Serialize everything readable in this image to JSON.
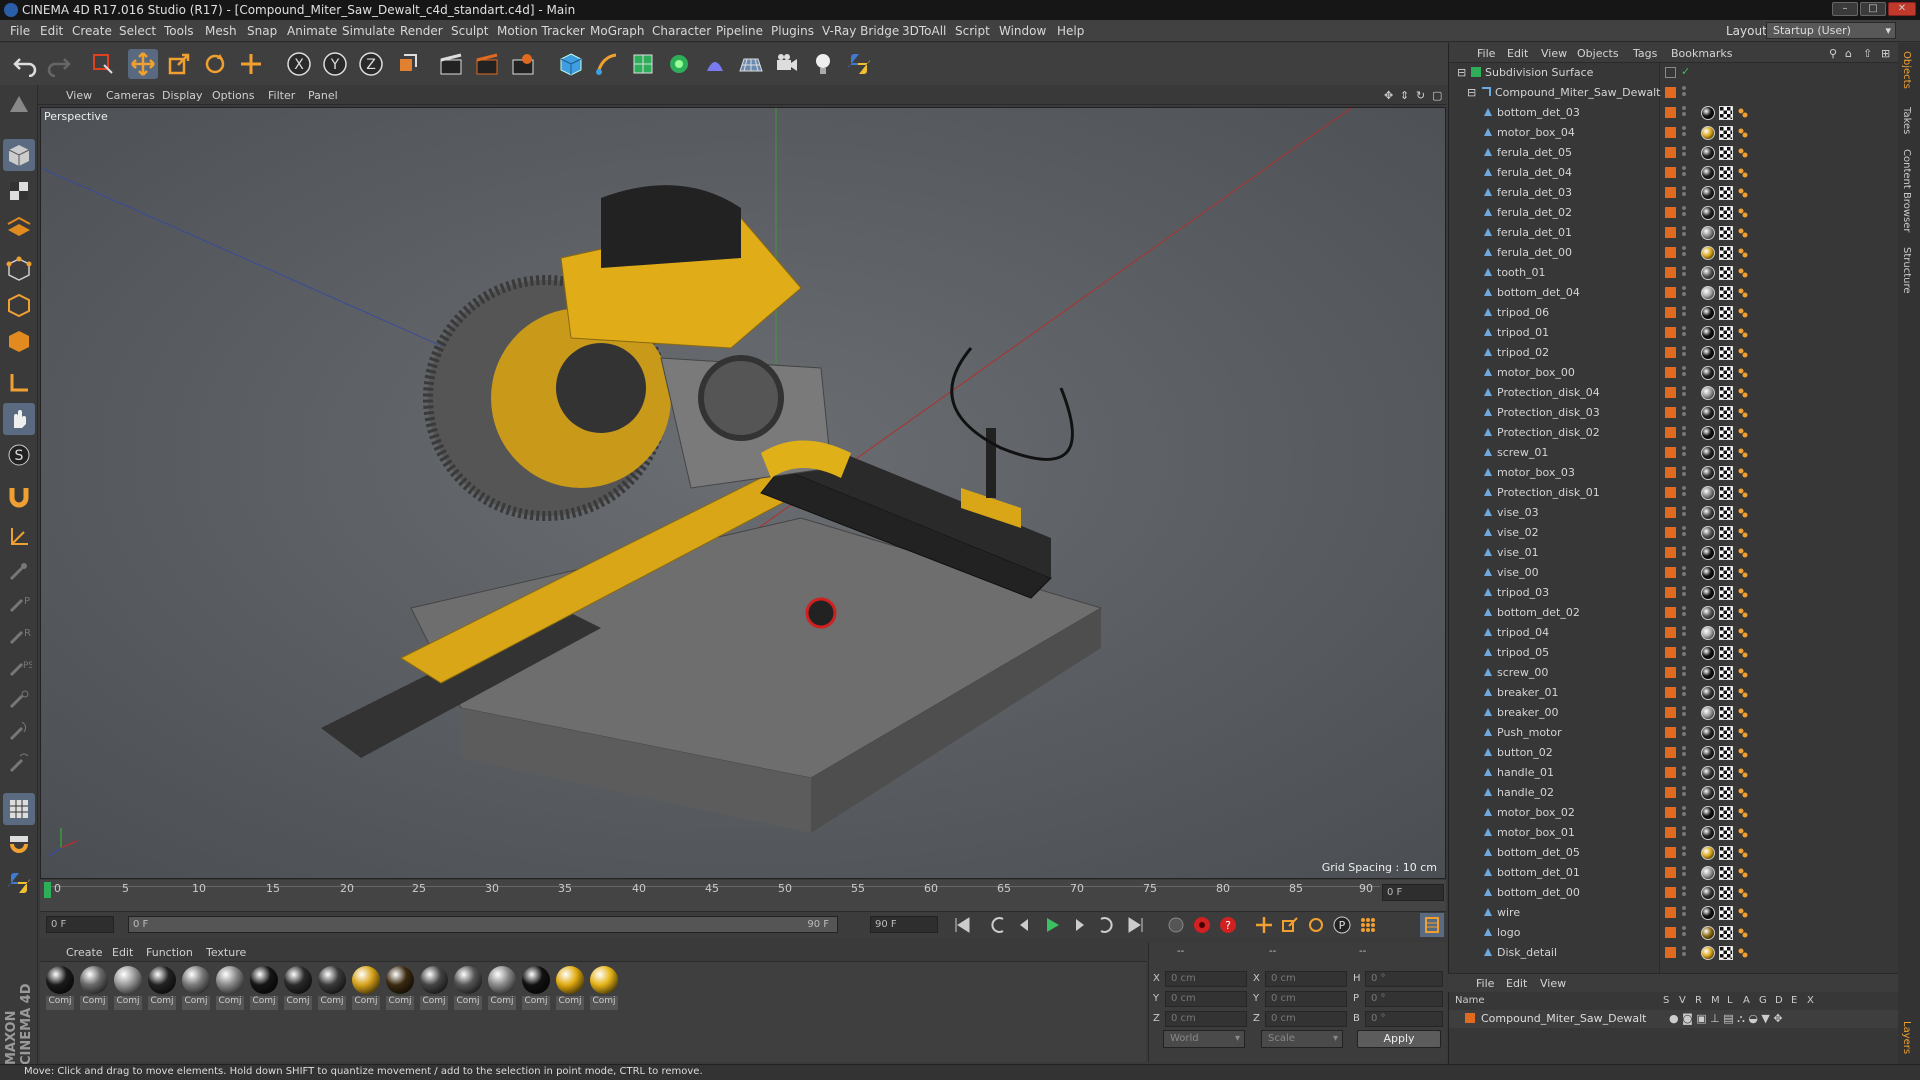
{
  "window": {
    "title": "CINEMA 4D R17.016 Studio (R17) - [Compound_Miter_Saw_Dewalt_c4d_standart.c4d] - Main"
  },
  "menu": [
    "File",
    "Edit",
    "Create",
    "Select",
    "Tools",
    "Mesh",
    "Snap",
    "Animate",
    "Simulate",
    "Render",
    "Sculpt",
    "Motion Tracker",
    "MoGraph",
    "Character",
    "Pipeline",
    "Plugins",
    "V-Ray Bridge",
    "3DToAll",
    "Script",
    "Window",
    "Help"
  ],
  "layout": {
    "label": "Layout:",
    "value": "Startup (User)"
  },
  "viewport": {
    "menu": [
      "View",
      "Cameras",
      "Display",
      "Options",
      "Filter",
      "Panel"
    ],
    "label": "Perspective",
    "grid_spacing": "Grid Spacing : 10 cm"
  },
  "timeline": {
    "ticks": [
      "0",
      "5",
      "10",
      "15",
      "20",
      "25",
      "30",
      "35",
      "40",
      "45",
      "50",
      "55",
      "60",
      "65",
      "70",
      "75",
      "80",
      "85",
      "90"
    ],
    "end_frame": "0 F",
    "current": "0 F",
    "range_start": "0 F",
    "range_end": "90 F",
    "range_end2": "90 F"
  },
  "materials": {
    "menu": [
      "Create",
      "Edit",
      "Function",
      "Texture"
    ],
    "items": [
      {
        "label": "Comj",
        "color": "#1a1a1a"
      },
      {
        "label": "Comj",
        "color": "#6a6a6a"
      },
      {
        "label": "Comj",
        "color": "#9a9a9a"
      },
      {
        "label": "Comj",
        "color": "#222222"
      },
      {
        "label": "Comj",
        "color": "#7a7a7a"
      },
      {
        "label": "Comj",
        "color": "#8a8a8a"
      },
      {
        "label": "Comj",
        "color": "#151515"
      },
      {
        "label": "Comj",
        "color": "#2a2a2a"
      },
      {
        "label": "Comj",
        "color": "#3a3a3a"
      },
      {
        "label": "Comj",
        "color": "#d7a21a"
      },
      {
        "label": "Comj",
        "color": "#3a2a10"
      },
      {
        "label": "Comj",
        "color": "#444444"
      },
      {
        "label": "Comj",
        "color": "#555555"
      },
      {
        "label": "Comj",
        "color": "#8a8a8a"
      },
      {
        "label": "Comj",
        "color": "#111111"
      },
      {
        "label": "Comj",
        "color": "#e0aa10"
      },
      {
        "label": "Comj",
        "color": "#e6b418"
      }
    ]
  },
  "coords": {
    "header": [
      "--",
      "--",
      "--"
    ],
    "rows": [
      {
        "a": "X",
        "av": "0 cm",
        "b": "X",
        "bv": "0 cm",
        "c": "H",
        "cv": "0 °"
      },
      {
        "a": "Y",
        "av": "0 cm",
        "b": "Y",
        "bv": "0 cm",
        "c": "P",
        "cv": "0 °"
      },
      {
        "a": "Z",
        "av": "0 cm",
        "b": "Z",
        "bv": "0 cm",
        "c": "B",
        "cv": "0 °"
      }
    ],
    "world": "World",
    "scale": "Scale",
    "apply": "Apply"
  },
  "status": "Move: Click and drag to move elements. Hold down SHIFT to quantize movement / add to the selection in point mode, CTRL to remove.",
  "objects": {
    "menu": [
      "File",
      "Edit",
      "View",
      "Objects",
      "Tags",
      "Bookmarks"
    ],
    "root": "Subdivision Surface",
    "group": "Compound_Miter_Saw_Dewalt",
    "items": [
      {
        "name": "bottom_det_03",
        "mat": "#111111"
      },
      {
        "name": "motor_box_04",
        "mat": "#d9a618"
      },
      {
        "name": "ferula_det_05",
        "mat": "#222222"
      },
      {
        "name": "ferula_det_04",
        "mat": "#222222"
      },
      {
        "name": "ferula_det_03",
        "mat": "#222222"
      },
      {
        "name": "ferula_det_02",
        "mat": "#222222"
      },
      {
        "name": "ferula_det_01",
        "mat": "#888888"
      },
      {
        "name": "ferula_det_00",
        "mat": "#d9a618"
      },
      {
        "name": "tooth_01",
        "mat": "#555555"
      },
      {
        "name": "bottom_det_04",
        "mat": "#aaaaaa"
      },
      {
        "name": "tripod_06",
        "mat": "#111111"
      },
      {
        "name": "tripod_01",
        "mat": "#111111"
      },
      {
        "name": "tripod_02",
        "mat": "#111111"
      },
      {
        "name": "motor_box_00",
        "mat": "#222222"
      },
      {
        "name": "Protection_disk_04",
        "mat": "#999999"
      },
      {
        "name": "Protection_disk_03",
        "mat": "#222222"
      },
      {
        "name": "Protection_disk_02",
        "mat": "#111111"
      },
      {
        "name": "screw_01",
        "mat": "#222222"
      },
      {
        "name": "motor_box_03",
        "mat": "#333333"
      },
      {
        "name": "Protection_disk_01",
        "mat": "#888888"
      },
      {
        "name": "vise_03",
        "mat": "#444444"
      },
      {
        "name": "vise_02",
        "mat": "#555555"
      },
      {
        "name": "vise_01",
        "mat": "#111111"
      },
      {
        "name": "vise_00",
        "mat": "#111111"
      },
      {
        "name": "tripod_03",
        "mat": "#111111"
      },
      {
        "name": "bottom_det_02",
        "mat": "#555555"
      },
      {
        "name": "tripod_04",
        "mat": "#aaaaaa"
      },
      {
        "name": "tripod_05",
        "mat": "#111111"
      },
      {
        "name": "screw_00",
        "mat": "#111111"
      },
      {
        "name": "breaker_01",
        "mat": "#333333"
      },
      {
        "name": "breaker_00",
        "mat": "#999999"
      },
      {
        "name": "Push_motor",
        "mat": "#222222"
      },
      {
        "name": "button_02",
        "mat": "#222222"
      },
      {
        "name": "handle_01",
        "mat": "#333333"
      },
      {
        "name": "handle_02",
        "mat": "#333333"
      },
      {
        "name": "motor_box_02",
        "mat": "#111111"
      },
      {
        "name": "motor_box_01",
        "mat": "#222222"
      },
      {
        "name": "bottom_det_05",
        "mat": "#d9a618"
      },
      {
        "name": "bottom_det_01",
        "mat": "#999999"
      },
      {
        "name": "bottom_det_00",
        "mat": "#333333"
      },
      {
        "name": "wire",
        "mat": "#111111"
      },
      {
        "name": "logo",
        "mat": "#8a6a10"
      },
      {
        "name": "Disk_detail",
        "mat": "#d9a618"
      }
    ]
  },
  "layers": {
    "menu": [
      "File",
      "Edit",
      "View"
    ],
    "cols_label": "Name",
    "cols": [
      "S",
      "V",
      "R",
      "M",
      "L",
      "A",
      "G",
      "D",
      "E",
      "X"
    ],
    "row": "Compound_Miter_Saw_Dewalt"
  },
  "right_tabs": [
    "Objects",
    "Takes",
    "Content Browser",
    "Structure"
  ],
  "right_tabs_bottom": [
    "Layers"
  ],
  "brand": "MAXON CINEMA 4D",
  "colors": {
    "accent_orange": "#e06a1f",
    "saw_yellow": "#e8b317",
    "object_icon": "#6fa8dc"
  }
}
